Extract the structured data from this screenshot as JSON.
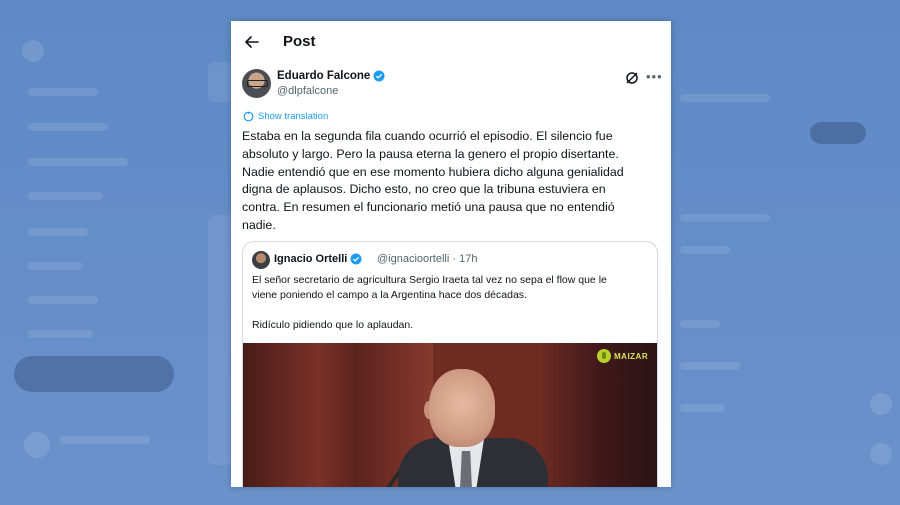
{
  "header": {
    "title": "Post"
  },
  "author": {
    "name": "Eduardo Falcone",
    "handle": "@dlpfalcone"
  },
  "translate_label": "Show translation",
  "post_text": "Estaba en la segunda fila cuando ocurrió el episodio. El silencio fue\nabsoluto y largo. Pero la pausa eterna la genero  el propio disertante.\nNadie entendió que en ese momento hubiera dicho alguna genialidad\ndigna de aplausos. Dicho esto, no creo que la tribuna estuviera en\ncontra. En resumen el funcionario metió una pausa que no entendió\nnadie.",
  "quote": {
    "name": "Ignacio Ortelli",
    "handle": "@ignacioortelli",
    "time": "17h",
    "separator": "·",
    "text": "El señor secretario de agricultura Sergio Iraeta tal vez no sepa el flow que le\nviene poniendo el campo a la Argentina hace dos décadas.\n\nRidículo pidiendo que lo aplaudan.",
    "media_logo": "MAIZAR"
  },
  "colors": {
    "accent": "#1d9bf0",
    "text": "#0f1419",
    "muted": "#536471",
    "background": "#5b87c4"
  },
  "icons": {
    "back": "arrow-left-icon",
    "verified": "verified-badge-icon",
    "grok": "grok-icon",
    "more": "more-horizontal-icon",
    "translate": "translate-icon"
  }
}
